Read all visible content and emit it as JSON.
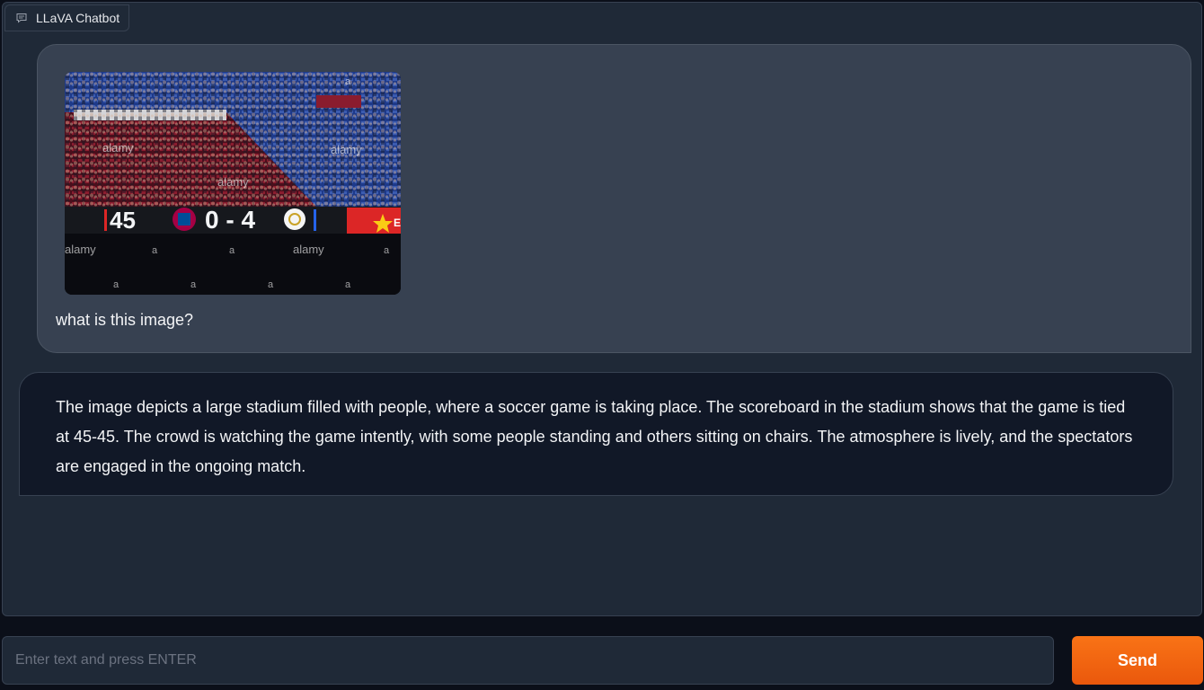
{
  "chatbot": {
    "label": "LLaVA Chatbot",
    "icon": "chat-bubble-icon"
  },
  "conversation": {
    "user_image": {
      "score_left": "45",
      "score_main": "0 - 4",
      "watermark": "alamy",
      "watermark_short": "a",
      "banner_letter": "E"
    },
    "user_text": "what is this image?",
    "bot_text": "The image depicts a large stadium filled with people, where a soccer game is taking place. The scoreboard in the stadium shows that the game is tied at 45-45. The crowd is watching the game intently, with some people standing and others sitting on chairs. The atmosphere is lively, and the spectators are engaged in the ongoing match."
  },
  "input": {
    "placeholder": "Enter text and press ENTER",
    "value": ""
  },
  "send_button": {
    "label": "Send"
  },
  "colors": {
    "accent": "#f97316",
    "panel": "#1f2937",
    "user_bubble": "#374151",
    "bot_bubble": "#111827"
  }
}
